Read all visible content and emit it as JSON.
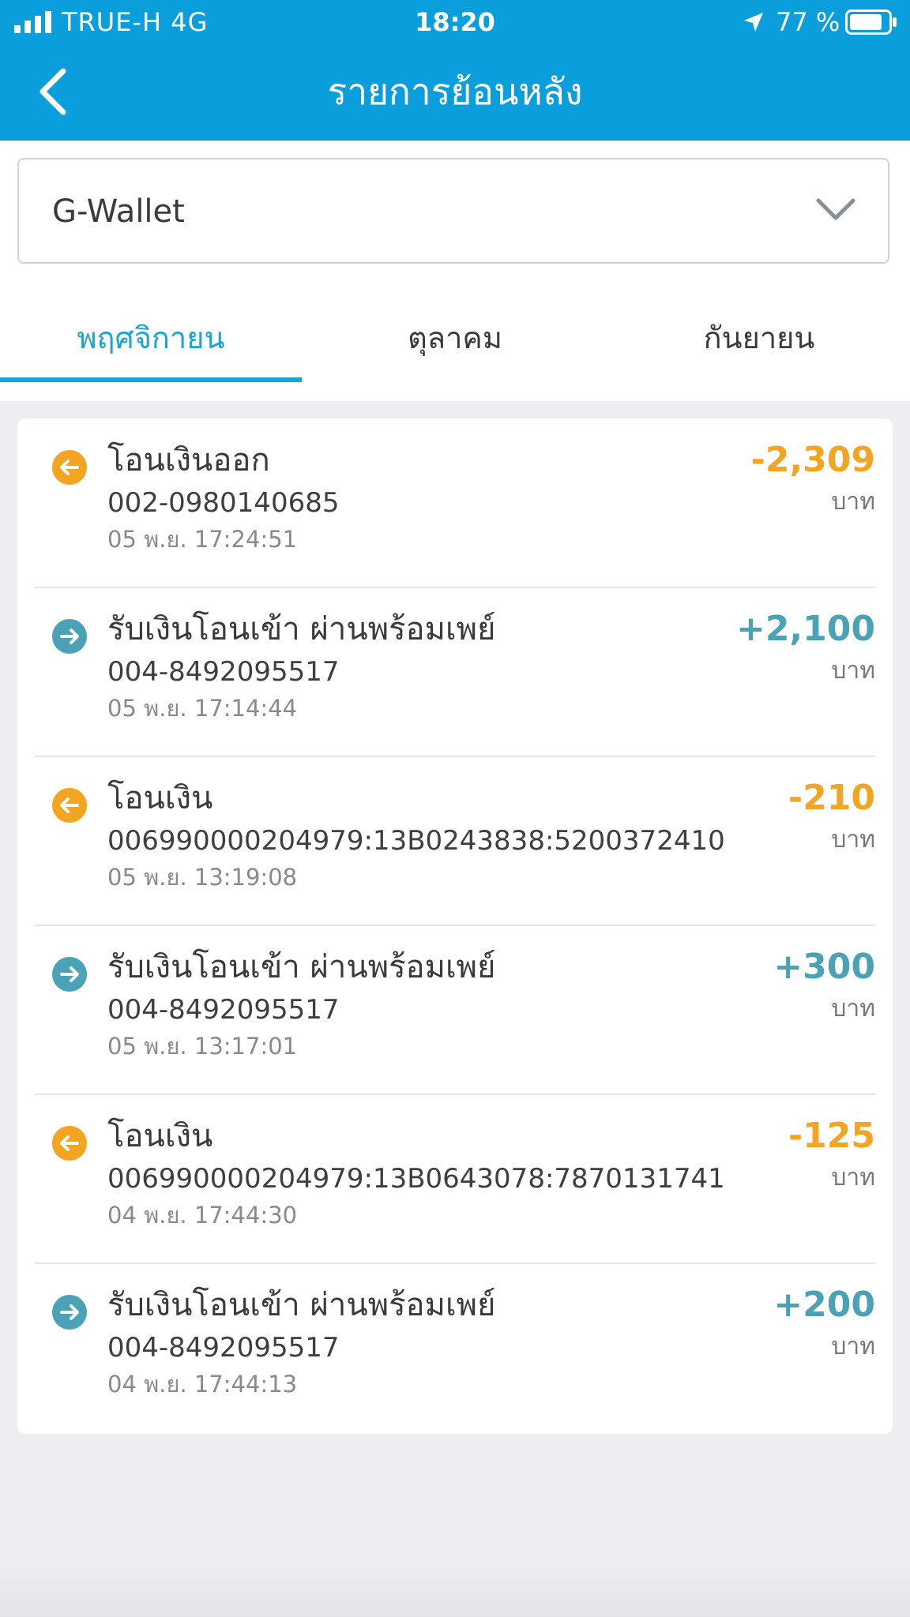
{
  "status_bar": {
    "carrier": "TRUE-H  4G",
    "time": "18:20",
    "battery_percent": "77 %"
  },
  "nav": {
    "title": "รายการย้อนหลัง",
    "back_icon": "chevron-left-icon"
  },
  "wallet_select": {
    "value": "G-Wallet",
    "icon": "chevron-down-icon"
  },
  "tabs": [
    {
      "label": "พฤศจิกายน",
      "active": true
    },
    {
      "label": "ตุลาคม",
      "active": false
    },
    {
      "label": "กันยายน",
      "active": false
    }
  ],
  "colors": {
    "header_blue": "#0a9fdc",
    "tab_active": "#1aa3d6",
    "outgoing": "#f3a421",
    "incoming": "#4aa2b6"
  },
  "transactions": [
    {
      "direction": "out",
      "icon": "arrow-left-circle-icon",
      "title": "โอนเงินออก",
      "ref": "002-0980140685",
      "time": "05 พ.ย. 17:24:51",
      "amount": "-2,309",
      "unit": "บาท"
    },
    {
      "direction": "in",
      "icon": "arrow-right-circle-icon",
      "title": "รับเงินโอนเข้า ผ่านพร้อมเพย์",
      "ref": "004-8492095517",
      "time": "05 พ.ย. 17:14:44",
      "amount": "+2,100",
      "unit": "บาท"
    },
    {
      "direction": "out",
      "icon": "arrow-left-circle-icon",
      "title": "โอนเงิน",
      "ref": "006990000204979:13B0243838:5200372410",
      "time": "05 พ.ย. 13:19:08",
      "amount": "-210",
      "unit": "บาท"
    },
    {
      "direction": "in",
      "icon": "arrow-right-circle-icon",
      "title": "รับเงินโอนเข้า ผ่านพร้อมเพย์",
      "ref": "004-8492095517",
      "time": "05 พ.ย. 13:17:01",
      "amount": "+300",
      "unit": "บาท"
    },
    {
      "direction": "out",
      "icon": "arrow-left-circle-icon",
      "title": "โอนเงิน",
      "ref": "006990000204979:13B0643078:7870131741",
      "time": "04 พ.ย. 17:44:30",
      "amount": "-125",
      "unit": "บาท"
    },
    {
      "direction": "in",
      "icon": "arrow-right-circle-icon",
      "title": "รับเงินโอนเข้า ผ่านพร้อมเพย์",
      "ref": "004-8492095517",
      "time": "04 พ.ย. 17:44:13",
      "amount": "+200",
      "unit": "บาท"
    }
  ]
}
